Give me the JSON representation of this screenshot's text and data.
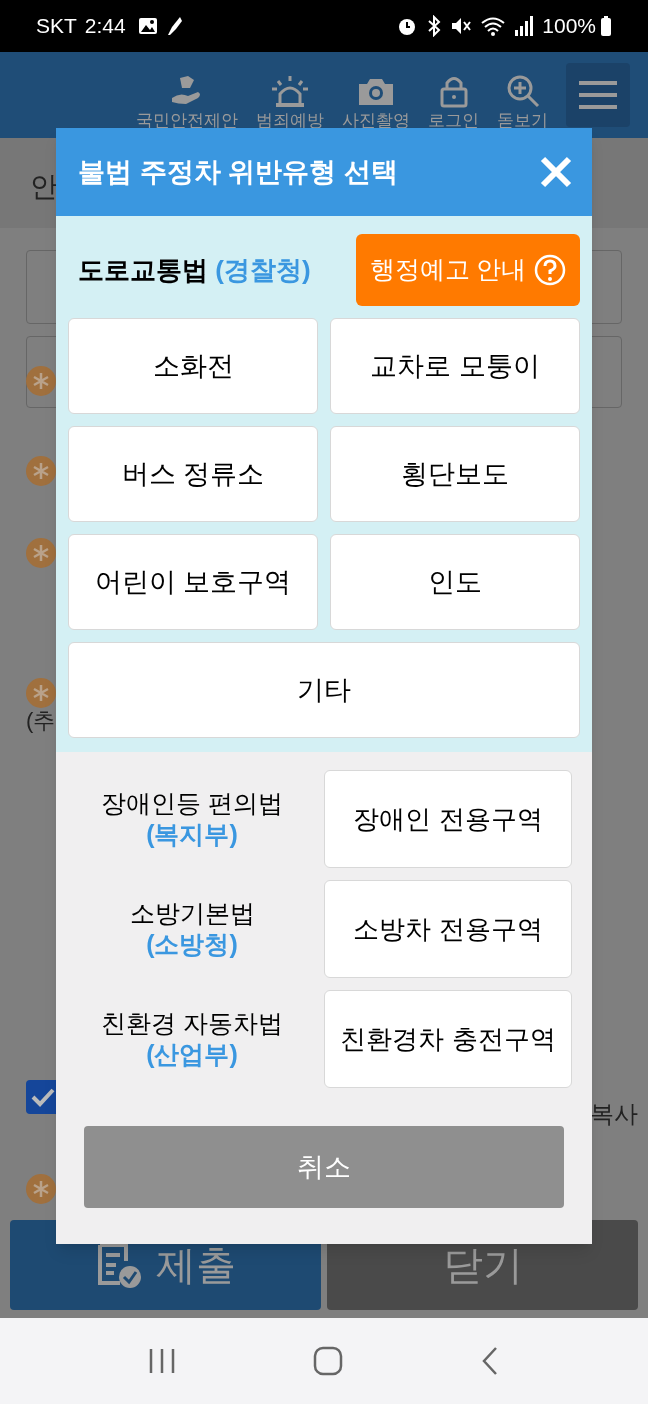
{
  "status_bar": {
    "carrier": "SKT",
    "time": "2:44",
    "battery": "100%"
  },
  "header": {
    "nav": [
      {
        "label": "국민안전제안",
        "kind": "hand"
      },
      {
        "label": "범죄예방",
        "kind": "siren"
      },
      {
        "label": "사진촬영",
        "kind": "camera"
      },
      {
        "label": "로그인",
        "kind": "lock"
      },
      {
        "label": "돋보기",
        "kind": "zoom"
      }
    ]
  },
  "page": {
    "title_fragment": "안",
    "note_fragment": "(추",
    "copy_fragment": "복사",
    "agree_checked": true
  },
  "footer_buttons": [
    {
      "label": "제출",
      "kind": "submit"
    },
    {
      "label": "닫기",
      "kind": "close"
    }
  ],
  "dialog": {
    "title": "불법 주정차 위반유형 선택",
    "road_law": {
      "name": "도로교통법",
      "agency": "(경찰청)"
    },
    "notice_button": "행정예고 안내",
    "road_options": [
      {
        "label": "소화전",
        "wide": false
      },
      {
        "label": "교차로 모퉁이",
        "wide": false
      },
      {
        "label": "버스 정류소",
        "wide": false
      },
      {
        "label": "횡단보도",
        "wide": false
      },
      {
        "label": "어린이 보호구역",
        "wide": false
      },
      {
        "label": "인도",
        "wide": false
      },
      {
        "label": "기타",
        "wide": true
      }
    ],
    "other_laws": [
      {
        "name": "장애인등 편의법",
        "agency": "(복지부)",
        "option": "장애인 전용구역"
      },
      {
        "name": "소방기본법",
        "agency": "(소방청)",
        "option": "소방차 전용구역"
      },
      {
        "name": "친환경 자동차법",
        "agency": "(산업부)",
        "option": "친환경차 충전구역"
      }
    ],
    "cancel": "취소"
  }
}
